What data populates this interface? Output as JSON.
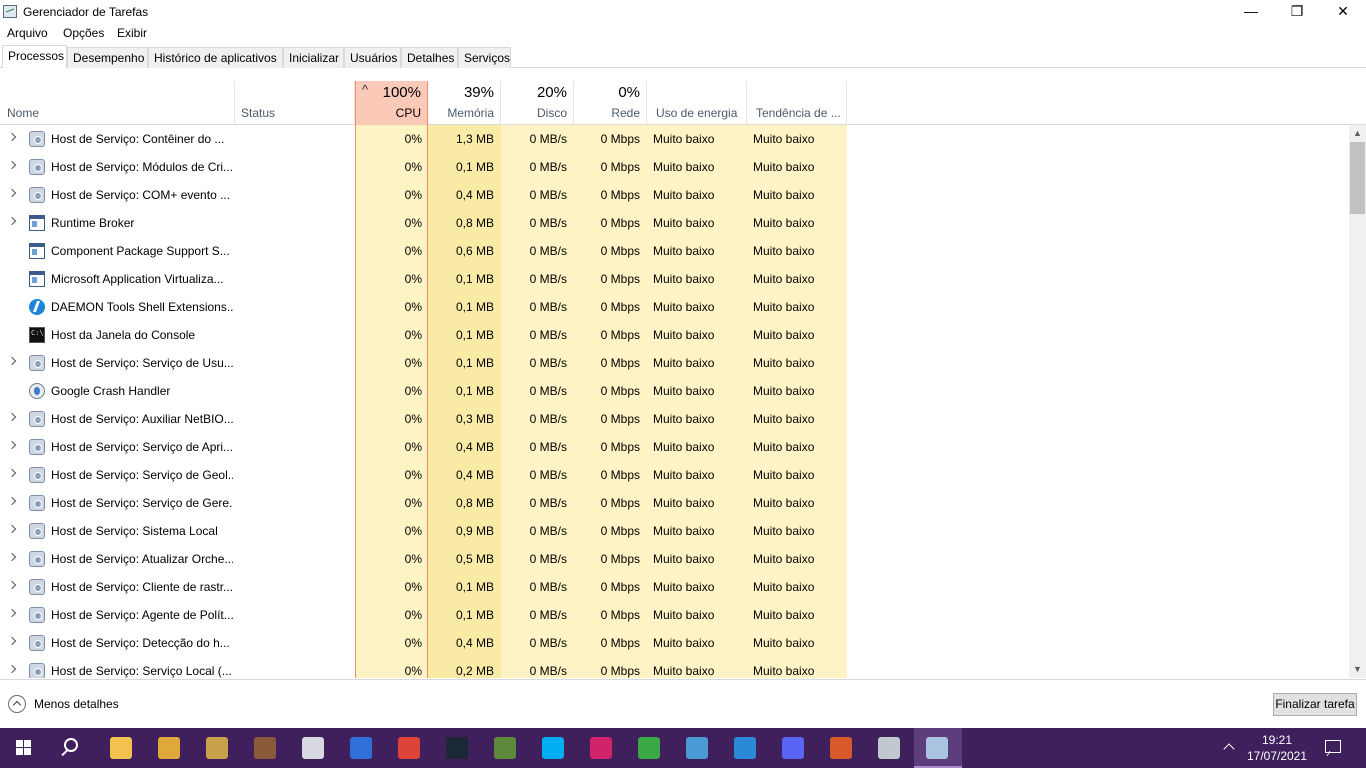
{
  "window": {
    "title": "Gerenciador de Tarefas",
    "minimize_glyph": "—",
    "maximize_glyph": "❐",
    "close_glyph": "✕"
  },
  "menu": [
    "Arquivo",
    "Opções",
    "Exibir"
  ],
  "tabs": [
    {
      "label": "Processos",
      "active": true
    },
    {
      "label": "Desempenho"
    },
    {
      "label": "Histórico de aplicativos"
    },
    {
      "label": "Inicializar"
    },
    {
      "label": "Usuários"
    },
    {
      "label": "Detalhes"
    },
    {
      "label": "Serviços"
    }
  ],
  "columns": {
    "name": "Nome",
    "status": "Status",
    "cpu": {
      "pct": "100%",
      "label": "CPU",
      "sort_glyph": "^"
    },
    "memory": {
      "pct": "39%",
      "label": "Memória"
    },
    "disk": {
      "pct": "20%",
      "label": "Disco"
    },
    "network": {
      "pct": "0%",
      "label": "Rede"
    },
    "power": "Uso de energia",
    "power_trend": "Tendência de ..."
  },
  "processes": [
    {
      "name": "Host de Serviço: Contêiner do ...",
      "icon": "gear",
      "expandable": true,
      "cpu": "0%",
      "mem": "1,3 MB",
      "disk": "0 MB/s",
      "net": "0 Mbps",
      "power": "Muito baixo",
      "trend": "Muito baixo"
    },
    {
      "name": "Host de Serviço: Módulos de Cri...",
      "icon": "gear",
      "expandable": true,
      "cpu": "0%",
      "mem": "0,1 MB",
      "disk": "0 MB/s",
      "net": "0 Mbps",
      "power": "Muito baixo",
      "trend": "Muito baixo"
    },
    {
      "name": "Host de Serviço: COM+ evento ...",
      "icon": "gear",
      "expandable": true,
      "cpu": "0%",
      "mem": "0,4 MB",
      "disk": "0 MB/s",
      "net": "0 Mbps",
      "power": "Muito baixo",
      "trend": "Muito baixo"
    },
    {
      "name": "Runtime Broker",
      "icon": "window",
      "expandable": true,
      "cpu": "0%",
      "mem": "0,8 MB",
      "disk": "0 MB/s",
      "net": "0 Mbps",
      "power": "Muito baixo",
      "trend": "Muito baixo"
    },
    {
      "name": "Component Package Support S...",
      "icon": "window",
      "expandable": false,
      "cpu": "0%",
      "mem": "0,6 MB",
      "disk": "0 MB/s",
      "net": "0 Mbps",
      "power": "Muito baixo",
      "trend": "Muito baixo"
    },
    {
      "name": "Microsoft Application Virtualiza...",
      "icon": "window",
      "expandable": false,
      "cpu": "0%",
      "mem": "0,1 MB",
      "disk": "0 MB/s",
      "net": "0 Mbps",
      "power": "Muito baixo",
      "trend": "Muito baixo"
    },
    {
      "name": "DAEMON Tools Shell Extensions...",
      "icon": "daemon",
      "expandable": false,
      "cpu": "0%",
      "mem": "0,1 MB",
      "disk": "0 MB/s",
      "net": "0 Mbps",
      "power": "Muito baixo",
      "trend": "Muito baixo"
    },
    {
      "name": "Host da Janela do Console",
      "icon": "console",
      "expandable": false,
      "cpu": "0%",
      "mem": "0,1 MB",
      "disk": "0 MB/s",
      "net": "0 Mbps",
      "power": "Muito baixo",
      "trend": "Muito baixo"
    },
    {
      "name": "Host de Serviço: Serviço de Usu...",
      "icon": "gear",
      "expandable": true,
      "cpu": "0%",
      "mem": "0,1 MB",
      "disk": "0 MB/s",
      "net": "0 Mbps",
      "power": "Muito baixo",
      "trend": "Muito baixo"
    },
    {
      "name": "Google Crash Handler",
      "icon": "crash",
      "expandable": false,
      "cpu": "0%",
      "mem": "0,1 MB",
      "disk": "0 MB/s",
      "net": "0 Mbps",
      "power": "Muito baixo",
      "trend": "Muito baixo"
    },
    {
      "name": "Host de Serviço: Auxiliar NetBIO...",
      "icon": "gear",
      "expandable": true,
      "cpu": "0%",
      "mem": "0,3 MB",
      "disk": "0 MB/s",
      "net": "0 Mbps",
      "power": "Muito baixo",
      "trend": "Muito baixo"
    },
    {
      "name": "Host de Serviço: Serviço de Apri...",
      "icon": "gear",
      "expandable": true,
      "cpu": "0%",
      "mem": "0,4 MB",
      "disk": "0 MB/s",
      "net": "0 Mbps",
      "power": "Muito baixo",
      "trend": "Muito baixo"
    },
    {
      "name": "Host de Serviço: Serviço de Geol...",
      "icon": "gear",
      "expandable": true,
      "cpu": "0%",
      "mem": "0,4 MB",
      "disk": "0 MB/s",
      "net": "0 Mbps",
      "power": "Muito baixo",
      "trend": "Muito baixo"
    },
    {
      "name": "Host de Serviço: Serviço de Gere...",
      "icon": "gear",
      "expandable": true,
      "cpu": "0%",
      "mem": "0,8 MB",
      "disk": "0 MB/s",
      "net": "0 Mbps",
      "power": "Muito baixo",
      "trend": "Muito baixo"
    },
    {
      "name": "Host de Serviço: Sistema Local",
      "icon": "gear",
      "expandable": true,
      "cpu": "0%",
      "mem": "0,9 MB",
      "disk": "0 MB/s",
      "net": "0 Mbps",
      "power": "Muito baixo",
      "trend": "Muito baixo"
    },
    {
      "name": "Host de Serviço: Atualizar Orche...",
      "icon": "gear",
      "expandable": true,
      "cpu": "0%",
      "mem": "0,5 MB",
      "disk": "0 MB/s",
      "net": "0 Mbps",
      "power": "Muito baixo",
      "trend": "Muito baixo"
    },
    {
      "name": "Host de Serviço: Cliente de rastr...",
      "icon": "gear",
      "expandable": true,
      "cpu": "0%",
      "mem": "0,1 MB",
      "disk": "0 MB/s",
      "net": "0 Mbps",
      "power": "Muito baixo",
      "trend": "Muito baixo"
    },
    {
      "name": "Host de Serviço: Agente de Polít...",
      "icon": "gear",
      "expandable": true,
      "cpu": "0%",
      "mem": "0,1 MB",
      "disk": "0 MB/s",
      "net": "0 Mbps",
      "power": "Muito baixo",
      "trend": "Muito baixo"
    },
    {
      "name": "Host de Serviço: Detecção do h...",
      "icon": "gear",
      "expandable": true,
      "cpu": "0%",
      "mem": "0,4 MB",
      "disk": "0 MB/s",
      "net": "0 Mbps",
      "power": "Muito baixo",
      "trend": "Muito baixo"
    },
    {
      "name": "Host de Serviço: Serviço Local (...",
      "icon": "gear",
      "expandable": true,
      "cpu": "0%",
      "mem": "0,2 MB",
      "disk": "0 MB/s",
      "net": "0 Mbps",
      "power": "Muito baixo",
      "trend": "Muito baixo"
    }
  ],
  "footer": {
    "less_details": "Menos detalhes",
    "end_task": "Finalizar tarefa"
  },
  "taskbar": {
    "apps": [
      {
        "name": "file-explorer",
        "color": "#f2c14e"
      },
      {
        "name": "app-2",
        "color": "#e0a83a"
      },
      {
        "name": "league-of-legends",
        "color": "#c8a24a"
      },
      {
        "name": "app-4",
        "color": "#8a5a3a"
      },
      {
        "name": "roblox",
        "color": "#d8d8e0"
      },
      {
        "name": "app-6",
        "color": "#2f6fd6"
      },
      {
        "name": "chrome",
        "color": "#db4437"
      },
      {
        "name": "steam",
        "color": "#1b2838"
      },
      {
        "name": "minecraft",
        "color": "#5c8a3a"
      },
      {
        "name": "skype",
        "color": "#00aff0"
      },
      {
        "name": "app-11",
        "color": "#d0246a"
      },
      {
        "name": "app-12",
        "color": "#3aa844"
      },
      {
        "name": "app-13",
        "color": "#4a9ad6"
      },
      {
        "name": "app-14",
        "color": "#2a8ad6"
      },
      {
        "name": "discord",
        "color": "#5865f2"
      },
      {
        "name": "app-16",
        "color": "#d85a2a"
      },
      {
        "name": "settings",
        "color": "#c0c8d0"
      },
      {
        "name": "task-manager",
        "color": "#a9c4e0",
        "active": true
      }
    ],
    "time": "19:21",
    "date": "17/07/2021"
  }
}
